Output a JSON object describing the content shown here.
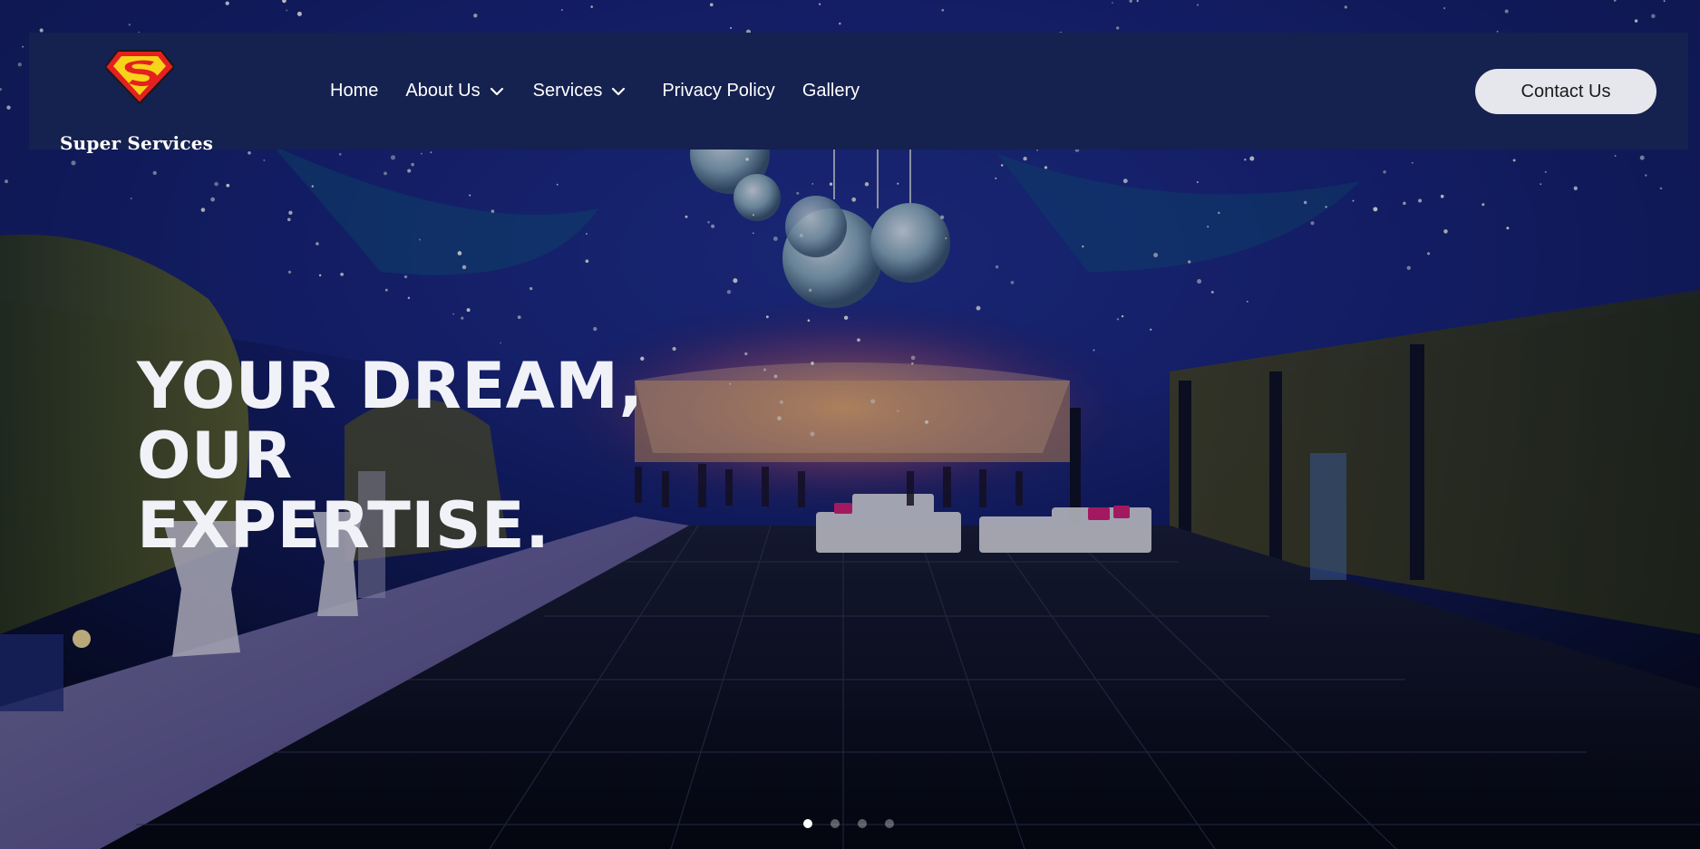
{
  "brand": {
    "name": "Super Services",
    "emblem_icon": "superman-shield-icon",
    "emblem_colors": {
      "fill": "#e5201f",
      "accent": "#f7d41a",
      "outline": "#1a1a1a"
    }
  },
  "nav": {
    "items": [
      {
        "label": "Home",
        "has_dropdown": false
      },
      {
        "label": "About Us",
        "has_dropdown": true,
        "icon": "chevron-down-icon"
      },
      {
        "label": "Services",
        "has_dropdown": true,
        "icon": "chevron-down-icon"
      },
      {
        "label": "Privacy Policy",
        "has_dropdown": false
      },
      {
        "label": "Gallery",
        "has_dropdown": false
      }
    ],
    "contact_label": "Contact Us"
  },
  "hero": {
    "headline_line1": "YOUR DREAM, OUR",
    "headline_line2": "EXPERTISE.",
    "background": "Illuminated event tent with star-lit ceiling, mirror balls, white lounge furniture and black reflective dance floor",
    "slides": {
      "count": 4,
      "active_index": 0
    }
  },
  "colors": {
    "navbar_bg": "#15214f",
    "contact_button_bg": "#e6e7ec",
    "headline_color": "#f1f2f8"
  }
}
